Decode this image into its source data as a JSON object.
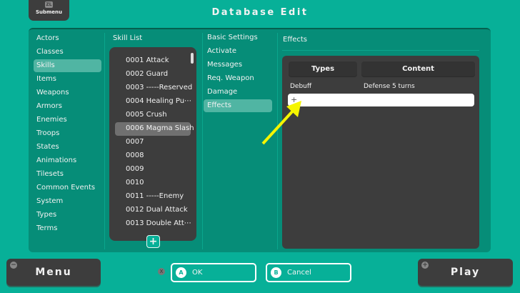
{
  "header": {
    "title": "Database Edit",
    "submenu_label": "Submenu",
    "submenu_key": "ZL"
  },
  "categories": [
    "Actors",
    "Classes",
    "Skills",
    "Items",
    "Weapons",
    "Armors",
    "Enemies",
    "Troops",
    "States",
    "Animations",
    "Tilesets",
    "Common Events",
    "System",
    "Types",
    "Terms"
  ],
  "selected_category": "Skills",
  "skill_list": {
    "title": "Skill List",
    "items": [
      "0001 Attack",
      "0002 Guard",
      "0003 -----Reserved",
      "0004 Healing Pu⋯",
      "0005 Crush",
      "0006 Magma Slash",
      "0007",
      "0008",
      "0009",
      "0010",
      "0011 -----Enemy",
      "0012 Dual Attack",
      "0013 Double Att⋯"
    ],
    "selected": "0006 Magma Slash",
    "add_label": "+"
  },
  "sections": {
    "items": [
      "Basic Settings",
      "Activate",
      "Messages",
      "Req. Weapon",
      "Damage",
      "Effects"
    ],
    "selected": "Effects"
  },
  "effects": {
    "title": "Effects",
    "columns": [
      "Types",
      "Content"
    ],
    "rows": [
      {
        "type": "Debuff",
        "content": "Defense 5 turns"
      }
    ],
    "add_row_label": "+"
  },
  "footer": {
    "menu": "Menu",
    "menu_key": "−",
    "ok": "OK",
    "ok_key": "A",
    "cancel": "Cancel",
    "cancel_key": "B",
    "x_key": "X",
    "play": "Play",
    "play_key": "+"
  },
  "colors": {
    "background": "#07b098",
    "panel": "#068d78",
    "dark": "#3d3d3d",
    "highlight": "#50b5a3",
    "arrow": "#f5f500"
  }
}
